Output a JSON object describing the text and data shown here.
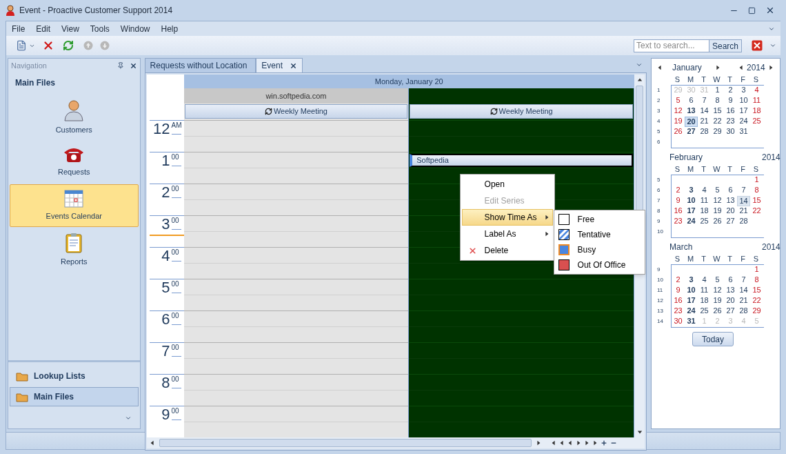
{
  "window": {
    "title": "Event - Proactive Customer Support 2014"
  },
  "menu": [
    "File",
    "Edit",
    "View",
    "Tools",
    "Window",
    "Help"
  ],
  "search": {
    "placeholder": "Text to search...",
    "button": "Search"
  },
  "navigation": {
    "title": "Navigation",
    "group": "Main Files",
    "items": [
      {
        "label": "Customers",
        "kind": "person",
        "selected": false
      },
      {
        "label": "Requests",
        "kind": "phone",
        "selected": false
      },
      {
        "label": "Events Calendar",
        "kind": "calendar",
        "selected": true
      },
      {
        "label": "Reports",
        "kind": "clipboard",
        "selected": false
      }
    ],
    "groups": [
      {
        "label": "Lookup Lists",
        "selected": false
      },
      {
        "label": "Main Files",
        "selected": true
      }
    ]
  },
  "tabs": [
    {
      "label": "Requests without Location",
      "selected": false,
      "closable": false
    },
    {
      "label": "Event",
      "selected": true,
      "closable": true
    }
  ],
  "scheduler": {
    "date": "Monday, January 20",
    "resources": [
      {
        "name": "win.softpedia.com",
        "color": "#e4e4e4",
        "all_day": "Weekly Meeting"
      },
      {
        "color": "#003300",
        "all_day": "Weekly Meeting"
      }
    ],
    "hours": [
      {
        "hour": "12",
        "suffix": "AM",
        "current": false
      },
      {
        "hour": "1",
        "suffix": "00",
        "current": false,
        "cells": [
          {},
          {
            "appointment": {
              "title": "Softpedia",
              "selected": true
            }
          }
        ]
      },
      {
        "hour": "2",
        "suffix": "00",
        "current": false
      },
      {
        "hour": "3",
        "suffix": "00",
        "current": true
      },
      {
        "hour": "4",
        "suffix": "00",
        "current": false
      },
      {
        "hour": "5",
        "suffix": "00",
        "current": false
      },
      {
        "hour": "6",
        "suffix": "00",
        "current": false
      },
      {
        "hour": "7",
        "suffix": "00",
        "current": false
      },
      {
        "hour": "8",
        "suffix": "00",
        "current": false
      },
      {
        "hour": "9",
        "suffix": "00",
        "current": false
      }
    ]
  },
  "context_menu": {
    "items": [
      {
        "label": "Open",
        "kind": "item",
        "disabled": false,
        "selected": false
      },
      {
        "label": "Edit Series",
        "kind": "item",
        "disabled": true,
        "selected": false
      },
      {
        "label": "Show Time As",
        "kind": "submenu",
        "disabled": false,
        "selected": true
      },
      {
        "label": "Label As",
        "kind": "submenu",
        "disabled": false,
        "selected": false
      },
      {
        "label": "Delete",
        "kind": "delete",
        "disabled": false,
        "selected": false
      }
    ],
    "submenu": [
      {
        "label": "Free",
        "kind": "free",
        "selected": false
      },
      {
        "label": "Tentative",
        "kind": "tentative",
        "selected": false
      },
      {
        "label": "Busy",
        "kind": "busy",
        "selected": true
      },
      {
        "label": "Out Of Office",
        "kind": "out-of-office",
        "selected": false
      }
    ]
  },
  "date_navigator": {
    "today_button": "Today",
    "months": [
      {
        "name": "January",
        "year": "2014",
        "arrows": true,
        "weekdays": [
          "S",
          "M",
          "T",
          "W",
          "T",
          "F",
          "S"
        ],
        "weeks": [
          {
            "number": "1",
            "days": [
              {
                "text": "29",
                "kind": "dim"
              },
              {
                "text": "30",
                "kind": "dim"
              },
              {
                "text": "31",
                "kind": "dim"
              },
              {
                "text": "1",
                "kind": "plain"
              },
              {
                "text": "2",
                "kind": "plain"
              },
              {
                "text": "3",
                "kind": "plain"
              },
              {
                "text": "4",
                "kind": "weekend"
              }
            ]
          },
          {
            "number": "2",
            "days": [
              {
                "text": "5",
                "kind": "weekend"
              },
              {
                "text": "6",
                "kind": "plain"
              },
              {
                "text": "7",
                "kind": "plain"
              },
              {
                "text": "8",
                "kind": "plain"
              },
              {
                "text": "9",
                "kind": "plain"
              },
              {
                "text": "10",
                "kind": "plain"
              },
              {
                "text": "11",
                "kind": "weekend"
              }
            ]
          },
          {
            "number": "3",
            "days": [
              {
                "text": "12",
                "kind": "weekend"
              },
              {
                "text": "13",
                "kind": "bold"
              },
              {
                "text": "14",
                "kind": "plain"
              },
              {
                "text": "15",
                "kind": "plain"
              },
              {
                "text": "16",
                "kind": "plain"
              },
              {
                "text": "17",
                "kind": "plain"
              },
              {
                "text": "18",
                "kind": "weekend"
              }
            ]
          },
          {
            "number": "4",
            "days": [
              {
                "text": "19",
                "kind": "weekend"
              },
              {
                "text": "20",
                "kind": "today"
              },
              {
                "text": "21",
                "kind": "plain"
              },
              {
                "text": "22",
                "kind": "plain"
              },
              {
                "text": "23",
                "kind": "plain"
              },
              {
                "text": "24",
                "kind": "plain"
              },
              {
                "text": "25",
                "kind": "weekend"
              }
            ]
          },
          {
            "number": "5",
            "days": [
              {
                "text": "26",
                "kind": "weekend"
              },
              {
                "text": "27",
                "kind": "bold"
              },
              {
                "text": "28",
                "kind": "plain"
              },
              {
                "text": "29",
                "kind": "plain"
              },
              {
                "text": "30",
                "kind": "plain"
              },
              {
                "text": "31",
                "kind": "plain"
              }
            ]
          },
          {
            "number": "6"
          }
        ]
      },
      {
        "name": "February",
        "year": "2014",
        "arrows": false,
        "weekdays": [
          "S",
          "M",
          "T",
          "W",
          "T",
          "F",
          "S"
        ],
        "weeks": [
          {
            "number": "5",
            "days": [
              {
                "kind": "blank"
              },
              {
                "kind": "blank"
              },
              {
                "kind": "blank"
              },
              {
                "kind": "blank"
              },
              {
                "kind": "blank"
              },
              {
                "kind": "blank"
              },
              {
                "text": "1",
                "kind": "weekend"
              }
            ]
          },
          {
            "number": "6",
            "days": [
              {
                "text": "2",
                "kind": "weekend"
              },
              {
                "text": "3",
                "kind": "bold"
              },
              {
                "text": "4",
                "kind": "plain"
              },
              {
                "text": "5",
                "kind": "plain"
              },
              {
                "text": "6",
                "kind": "plain"
              },
              {
                "text": "7",
                "kind": "plain"
              },
              {
                "text": "8",
                "kind": "weekend"
              }
            ]
          },
          {
            "number": "7",
            "days": [
              {
                "text": "9",
                "kind": "weekend"
              },
              {
                "text": "10",
                "kind": "bold"
              },
              {
                "text": "11",
                "kind": "plain"
              },
              {
                "text": "12",
                "kind": "plain"
              },
              {
                "text": "13",
                "kind": "plain"
              },
              {
                "text": "14",
                "kind": "marked"
              },
              {
                "text": "15",
                "kind": "weekend"
              }
            ]
          },
          {
            "number": "8",
            "days": [
              {
                "text": "16",
                "kind": "weekend"
              },
              {
                "text": "17",
                "kind": "bold"
              },
              {
                "text": "18",
                "kind": "plain"
              },
              {
                "text": "19",
                "kind": "plain"
              },
              {
                "text": "20",
                "kind": "plain"
              },
              {
                "text": "21",
                "kind": "plain"
              },
              {
                "text": "22",
                "kind": "weekend"
              }
            ]
          },
          {
            "number": "9",
            "days": [
              {
                "text": "23",
                "kind": "weekend"
              },
              {
                "text": "24",
                "kind": "bold"
              },
              {
                "text": "25",
                "kind": "plain"
              },
              {
                "text": "26",
                "kind": "plain"
              },
              {
                "text": "27",
                "kind": "plain"
              },
              {
                "text": "28",
                "kind": "plain"
              }
            ]
          },
          {
            "number": "10"
          }
        ]
      },
      {
        "name": "March",
        "year": "2014",
        "arrows": false,
        "weekdays": [
          "S",
          "M",
          "T",
          "W",
          "T",
          "F",
          "S"
        ],
        "weeks": [
          {
            "number": "9",
            "days": [
              {
                "kind": "blank"
              },
              {
                "kind": "blank"
              },
              {
                "kind": "blank"
              },
              {
                "kind": "blank"
              },
              {
                "kind": "blank"
              },
              {
                "kind": "blank"
              },
              {
                "text": "1",
                "kind": "weekend"
              }
            ]
          },
          {
            "number": "10",
            "days": [
              {
                "text": "2",
                "kind": "weekend"
              },
              {
                "text": "3",
                "kind": "bold"
              },
              {
                "text": "4",
                "kind": "plain"
              },
              {
                "text": "5",
                "kind": "plain"
              },
              {
                "text": "6",
                "kind": "plain"
              },
              {
                "text": "7",
                "kind": "plain"
              },
              {
                "text": "8",
                "kind": "weekend"
              }
            ]
          },
          {
            "number": "11",
            "days": [
              {
                "text": "9",
                "kind": "weekend"
              },
              {
                "text": "10",
                "kind": "bold"
              },
              {
                "text": "11",
                "kind": "plain"
              },
              {
                "text": "12",
                "kind": "plain"
              },
              {
                "text": "13",
                "kind": "plain"
              },
              {
                "text": "14",
                "kind": "plain"
              },
              {
                "text": "15",
                "kind": "weekend"
              }
            ]
          },
          {
            "number": "12",
            "days": [
              {
                "text": "16",
                "kind": "weekend"
              },
              {
                "text": "17",
                "kind": "bold"
              },
              {
                "text": "18",
                "kind": "plain"
              },
              {
                "text": "19",
                "kind": "plain"
              },
              {
                "text": "20",
                "kind": "plain"
              },
              {
                "text": "21",
                "kind": "plain"
              },
              {
                "text": "22",
                "kind": "weekend"
              }
            ]
          },
          {
            "number": "13",
            "days": [
              {
                "text": "23",
                "kind": "weekend"
              },
              {
                "text": "24",
                "kind": "bold"
              },
              {
                "text": "25",
                "kind": "plain"
              },
              {
                "text": "26",
                "kind": "plain"
              },
              {
                "text": "27",
                "kind": "plain"
              },
              {
                "text": "28",
                "kind": "plain"
              },
              {
                "text": "29",
                "kind": "weekend"
              }
            ]
          },
          {
            "number": "14",
            "days": [
              {
                "text": "30",
                "kind": "weekend"
              },
              {
                "text": "31",
                "kind": "bold"
              },
              {
                "text": "1",
                "kind": "dim"
              },
              {
                "text": "2",
                "kind": "dim"
              },
              {
                "text": "3",
                "kind": "dim"
              },
              {
                "text": "4",
                "kind": "dim"
              },
              {
                "text": "5",
                "kind": "dim"
              }
            ]
          }
        ]
      }
    ]
  }
}
